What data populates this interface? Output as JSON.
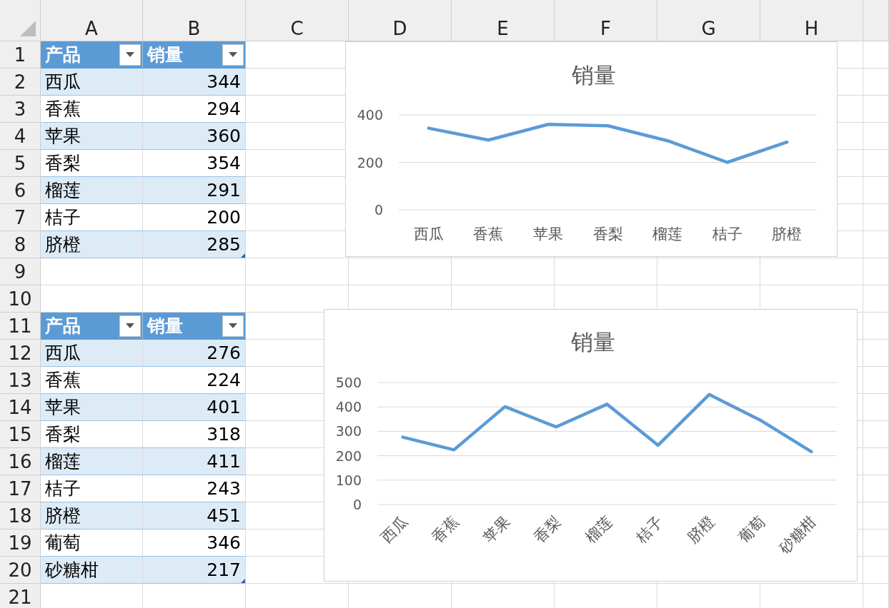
{
  "columns": [
    "A",
    "B",
    "C",
    "D",
    "E",
    "F",
    "G",
    "H"
  ],
  "rows": [
    {
      "number": "1",
      "kind": "header",
      "cells": [
        "产品",
        "销量"
      ]
    },
    {
      "number": "2",
      "kind": "data",
      "banded": true,
      "cells": [
        "西瓜",
        "344"
      ]
    },
    {
      "number": "3",
      "kind": "data",
      "banded": false,
      "cells": [
        "香蕉",
        "294"
      ]
    },
    {
      "number": "4",
      "kind": "data",
      "banded": true,
      "cells": [
        "苹果",
        "360"
      ]
    },
    {
      "number": "5",
      "kind": "data",
      "banded": false,
      "cells": [
        "香梨",
        "354"
      ]
    },
    {
      "number": "6",
      "kind": "data",
      "banded": true,
      "cells": [
        "榴莲",
        "291"
      ]
    },
    {
      "number": "7",
      "kind": "data",
      "banded": false,
      "cells": [
        "桔子",
        "200"
      ]
    },
    {
      "number": "8",
      "kind": "data",
      "banded": true,
      "resize_handle": true,
      "cells": [
        "脐橙",
        "285"
      ]
    },
    {
      "number": "9",
      "kind": "empty"
    },
    {
      "number": "10",
      "kind": "empty"
    },
    {
      "number": "11",
      "kind": "header",
      "cells": [
        "产品",
        "销量"
      ]
    },
    {
      "number": "12",
      "kind": "data",
      "banded": true,
      "cells": [
        "西瓜",
        "276"
      ]
    },
    {
      "number": "13",
      "kind": "data",
      "banded": false,
      "cells": [
        "香蕉",
        "224"
      ]
    },
    {
      "number": "14",
      "kind": "data",
      "banded": true,
      "cells": [
        "苹果",
        "401"
      ]
    },
    {
      "number": "15",
      "kind": "data",
      "banded": false,
      "cells": [
        "香梨",
        "318"
      ]
    },
    {
      "number": "16",
      "kind": "data",
      "banded": true,
      "cells": [
        "榴莲",
        "411"
      ]
    },
    {
      "number": "17",
      "kind": "data",
      "banded": false,
      "cells": [
        "桔子",
        "243"
      ]
    },
    {
      "number": "18",
      "kind": "data",
      "banded": true,
      "cells": [
        "脐橙",
        "451"
      ]
    },
    {
      "number": "19",
      "kind": "data",
      "banded": false,
      "cells": [
        "葡萄",
        "346"
      ]
    },
    {
      "number": "20",
      "kind": "data",
      "banded": true,
      "resize_handle": true,
      "cells": [
        "砂糖柑",
        "217"
      ]
    },
    {
      "number": "21",
      "kind": "empty"
    }
  ],
  "charts": [
    {
      "chart_data": {
        "type": "line",
        "title": "销量",
        "categories": [
          "西瓜",
          "香蕉",
          "苹果",
          "香梨",
          "榴莲",
          "桔子",
          "脐橙"
        ],
        "series": [
          {
            "color": "#5b9bd5",
            "values": [
              344,
              294,
              360,
              354,
              291,
              200,
              285
            ]
          }
        ],
        "ylim": [
          0,
          400
        ],
        "yticks": [
          0,
          200,
          400
        ],
        "grid": true
      }
    },
    {
      "chart_data": {
        "type": "line",
        "title": "销量",
        "categories": [
          "西瓜",
          "香蕉",
          "苹果",
          "香梨",
          "榴莲",
          "桔子",
          "脐橙",
          "葡萄",
          "砂糖柑"
        ],
        "series": [
          {
            "color": "#5b9bd5",
            "values": [
              276,
              224,
              401,
              318,
              411,
              243,
              451,
              346,
              217
            ]
          }
        ],
        "ylim": [
          0,
          500
        ],
        "yticks": [
          0,
          100,
          200,
          300,
          400,
          500
        ],
        "grid": true
      }
    }
  ]
}
